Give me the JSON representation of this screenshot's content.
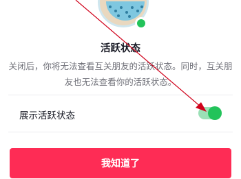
{
  "dialog": {
    "title": "活跃状态",
    "description": "关闭后，你将无法查看互关朋友的活跃状态。同时，互关朋友也无法查看你的活跃状态。",
    "toggle_label": "展示活跃状态",
    "toggle_on": true,
    "confirm_label": "我知道了"
  },
  "colors": {
    "accent": "#fe2c55",
    "toggle_on": "#22c35a",
    "annotation_arrow": "#d0021b"
  },
  "icons": {
    "illustration": "avatar-illustration-icon",
    "status": "online-status-dot-icon"
  }
}
